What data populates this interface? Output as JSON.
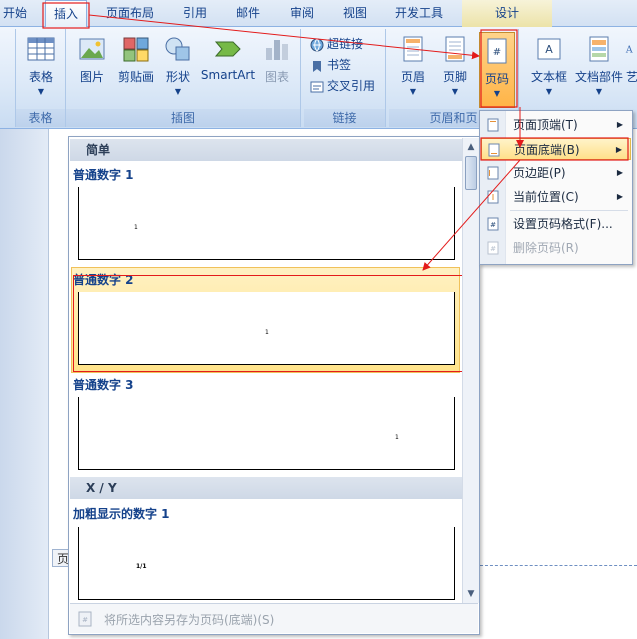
{
  "tabs": [
    "开始",
    "插入",
    "页面布局",
    "引用",
    "邮件",
    "审阅",
    "视图",
    "开发工具",
    "设计"
  ],
  "ribbon": {
    "groups": {
      "tables": {
        "label": "表格",
        "buttons": [
          "表格"
        ]
      },
      "illustrations": {
        "label": "插图",
        "buttons": [
          "图片",
          "剪贴画",
          "形状",
          "SmartArt",
          "图表"
        ]
      },
      "links": {
        "label": "链接",
        "buttons": [
          "超链接",
          "书签",
          "交叉引用"
        ]
      },
      "header_footer": {
        "label": "页眉和页",
        "buttons": [
          "页眉",
          "页脚",
          "页码"
        ]
      },
      "text": {
        "buttons": [
          "文本框",
          "文档部件",
          "艺"
        ]
      }
    }
  },
  "gallery": {
    "sections": [
      "简单",
      "X / Y"
    ],
    "items": [
      {
        "title": "普通数字 1",
        "sample": "1"
      },
      {
        "title": "普通数字 2",
        "sample": "1"
      },
      {
        "title": "普通数字 3",
        "sample": "1"
      },
      {
        "title": "加粗显示的数字 1",
        "sample": "1/1"
      }
    ],
    "footer_text": "将所选内容另存为页码(底端)(S)"
  },
  "context_menu": {
    "items": [
      {
        "label": "页面顶端(T)",
        "submenu": true
      },
      {
        "label": "页面底端(B)",
        "submenu": true,
        "highlighted": true
      },
      {
        "label": "页边距(P)",
        "submenu": true
      },
      {
        "label": "当前位置(C)",
        "submenu": true
      },
      {
        "label": "设置页码格式(F)...",
        "submenu": false
      },
      {
        "label": "删除页码(R)",
        "submenu": false,
        "disabled": true
      }
    ]
  },
  "document": {
    "footer_tag": "页"
  },
  "colors": {
    "ribbon_text": "#15428b",
    "highlight": "#ffe38a",
    "annotation": "#e31b1b"
  }
}
